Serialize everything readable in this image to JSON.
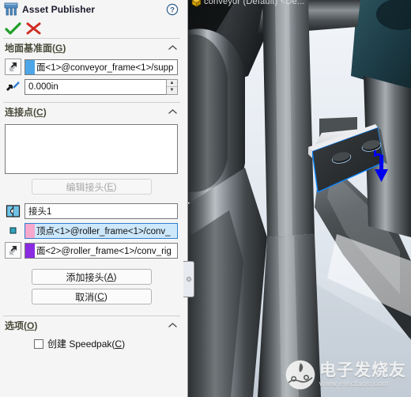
{
  "panel": {
    "title": "Asset Publisher",
    "title_icon": "asset-publisher-icon",
    "help_icon": "help-icon",
    "ok_label": "✔",
    "cancel_label": "✖",
    "sections": [
      {
        "id": "ground-plane",
        "title": "地面基准面",
        "mnemonic": "G",
        "collapsed": false
      },
      {
        "id": "connection-points",
        "title": "连接点",
        "mnemonic": "C",
        "collapsed": false
      },
      {
        "id": "options",
        "title": "选项",
        "mnemonic": "O",
        "collapsed": false
      }
    ],
    "ground_plane": {
      "face_select_icon": "face-select-icon",
      "face_value": "面<1>@conveyor_frame<1>/supp",
      "swatch_color": "#4da6e8",
      "offset_icon": "offset-distance-icon",
      "offset_value": "0.000in",
      "spin_up": "▲",
      "spin_down": "▼"
    },
    "connection_points": {
      "list_items": [],
      "edit_connector_label": "编辑接头",
      "edit_connector_mnemonic": "E",
      "edit_connector_disabled": true,
      "connector_icon": "connector-puzzle-icon",
      "connector_name": "接头1",
      "entities": [
        {
          "icon": "vertex-point-icon",
          "swatch_color": "#f7a8cd",
          "value": "顶点<1>@roller_frame<1>/conv_",
          "selected": true
        },
        {
          "icon": "face-select-icon",
          "swatch_color": "#8a2be2",
          "value": "面<2>@roller_frame<1>/conv_rig",
          "selected": false
        }
      ],
      "add_connector_label": "添加接头",
      "add_connector_mnemonic": "A",
      "cancel_label": "取消",
      "cancel_mnemonic": "C"
    },
    "options": {
      "speedpak_label_prefix": "创建 ",
      "speedpak_label_main": "Speedpak",
      "speedpak_mnemonic": "C",
      "speedpak_checked": false
    },
    "splitter_icon": "panel-resize-handle"
  },
  "viewport": {
    "tree_text": "conveyor (Default) <De...",
    "tree_icon": "assembly-icon",
    "selected_face_color": "#0a84ff",
    "direction_arrow_color": "#0000ee",
    "background_top": "#f0f3f7",
    "background_bottom": "#c9d2dc"
  },
  "watermark": {
    "cn": "电子发烧友",
    "url": "www.elecfans.com",
    "logo_icon": "elecfans-logo-icon"
  }
}
